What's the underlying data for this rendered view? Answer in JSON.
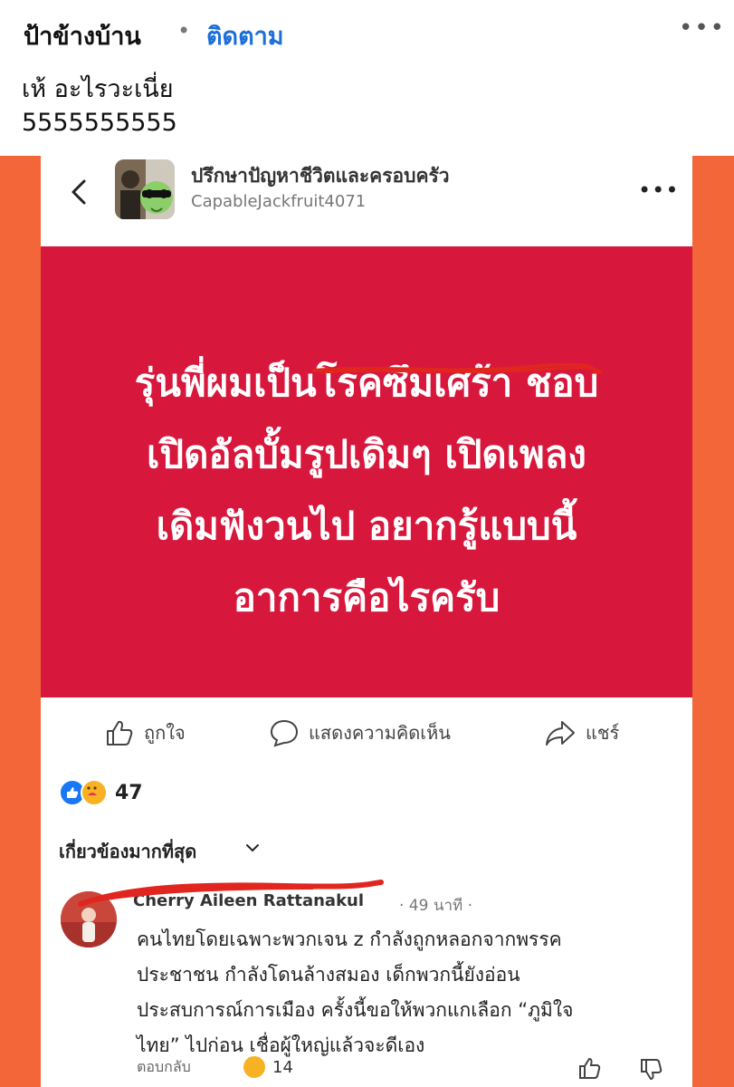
{
  "post": {
    "author": "ป้าข้างบ้าน",
    "separator": "•",
    "follow_label": "ติดตาม",
    "more_label": "•••",
    "caption_line1": "เห้ อะไรวะเนี่ย",
    "caption_line2": "5555555555"
  },
  "shared": {
    "group_name": "ปรึกษาปัญหาชีวิตและครอบครัว",
    "username": "CapableJackfruit4071",
    "more_label": "•••",
    "banner_lines": [
      "รุ่นพี่ผมเป็นโรคซึมเศร้า ชอบ",
      "เปิดอัลบั้มรูปเดิมๆ เปิดเพลง",
      "เดิมฟังวนไป อยากรู้แบบนี้",
      "อาการคือไรครับ"
    ],
    "actions": {
      "like": "ถูกใจ",
      "comment": "แสดงความคิดเห็น",
      "share": "แชร์"
    },
    "reaction_count": "47",
    "sort_label": "เกี่ยวข้องมากที่สุด",
    "comment": {
      "author": "Cherry Aileen Rattanakul",
      "time": "· 49 นาที ·",
      "lines": [
        "คนไทยโดยเฉพาะพวกเจน z กำลังถูกหลอกจากพรรค",
        "ประชาชน กำลังโดนล้างสมอง เด็กพวกนี้ยังอ่อน",
        "ประสบการณ์การเมือง ครั้งนี้ขอให้พวกแกเลือก “ภูมิใจ",
        "ไทย” ไปก่อน เชื่อผู้ใหญ่แล้วจะดีเอง"
      ],
      "reply_label": "ตอบกลับ",
      "reaction_count": "14"
    }
  },
  "colors": {
    "frame": "#f2663a",
    "banner": "#d7173c",
    "follow": "#1b6fd8",
    "scribble": "#e0261f"
  }
}
